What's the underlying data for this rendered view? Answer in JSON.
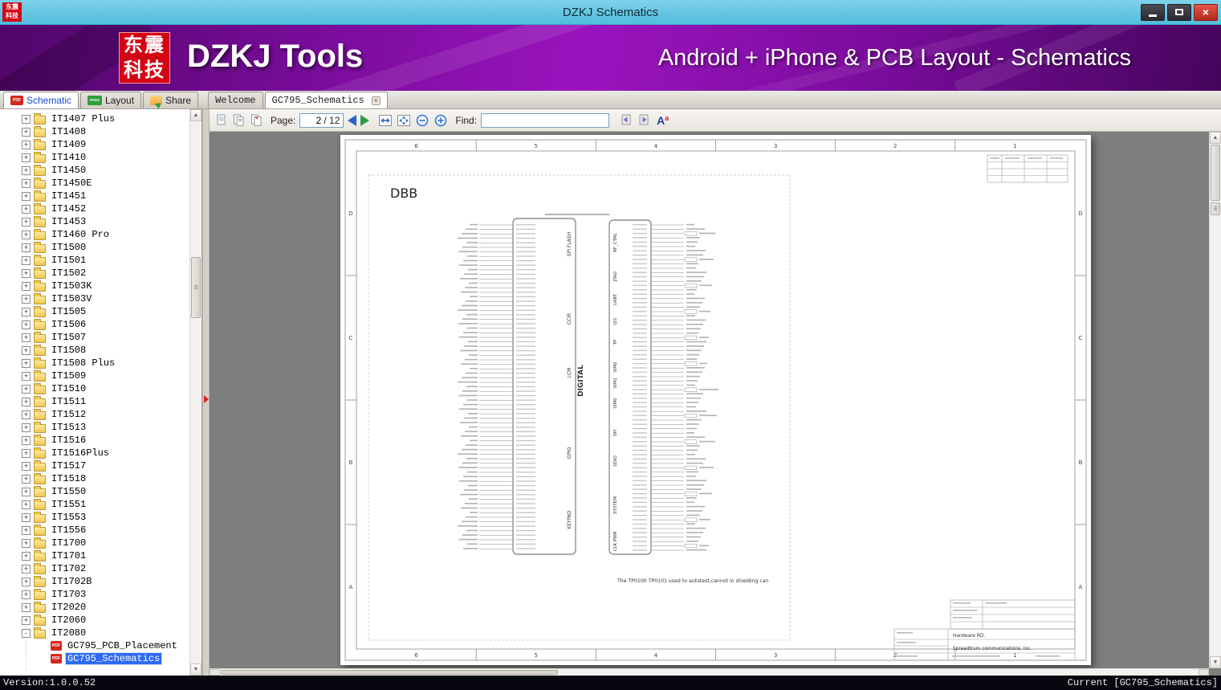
{
  "window": {
    "title": "DZKJ Schematics"
  },
  "banner": {
    "logo_line1": "东震",
    "logo_line2": "科技",
    "brand": "DZKJ Tools",
    "tagline": "Android + iPhone & PCB Layout - Schematics"
  },
  "icons": {
    "pdf_badge": "PDF",
    "pads_badge": "PADS",
    "font_big": "A",
    "font_small": "a"
  },
  "tabs": {
    "app": [
      {
        "label": "Schematic",
        "active": true
      },
      {
        "label": "Layout",
        "active": false
      },
      {
        "label": "Share",
        "active": false
      }
    ],
    "docs": [
      {
        "label": "Welcome",
        "active": false
      },
      {
        "label": "GC795_Schematics",
        "active": true
      }
    ]
  },
  "toolbar": {
    "page_label": "Page:",
    "page_value": "2",
    "page_total": "/ 12",
    "find_label": "Find:",
    "find_value": ""
  },
  "sidebar": {
    "folders": [
      "IT1407 Plus",
      "IT1408",
      "IT1409",
      "IT1410",
      "IT1450",
      "IT1450E",
      "IT1451",
      "IT1452",
      "IT1453",
      "IT1460 Pro",
      "IT1500",
      "IT1501",
      "IT1502",
      "IT1503K",
      "IT1503V",
      "IT1505",
      "IT1506",
      "IT1507",
      "IT1508",
      "IT1508 Plus",
      "IT1509",
      "IT1510",
      "IT1511",
      "IT1512",
      "IT1513",
      "IT1516",
      "IT1516Plus",
      "IT1517",
      "IT1518",
      "IT1550",
      "IT1551",
      "IT1553",
      "IT1556",
      "IT1700",
      "IT1701",
      "IT1702",
      "IT1702B",
      "IT1703",
      "IT2020",
      "IT2060"
    ],
    "expanded": {
      "name": "IT2080",
      "children": [
        {
          "label": "GC795_PCB_Placement",
          "selected": false
        },
        {
          "label": "GC795_Schematics",
          "selected": true
        }
      ]
    }
  },
  "schematic": {
    "page_title": "DBB",
    "column_labels": [
      "6",
      "5",
      "4",
      "3",
      "2",
      "1"
    ],
    "row_labels": [
      "D",
      "C",
      "B",
      "A"
    ],
    "left_blocks": [
      "SPI FLASH",
      "CCIR",
      "LCM",
      "GPIO",
      "KEYPAD"
    ],
    "chip_label": "DIGITAL",
    "right_blocks": [
      "RF_CTRL",
      "JTAG",
      "UART",
      "I2S",
      "TP",
      "SIM2",
      "SIM1",
      "SIM0",
      "SPI",
      "SDIO",
      "SYSTEM",
      "CLK PWR"
    ],
    "note": "The TP0100 TP0101 used to autotest,cannot in shielding can",
    "title_block": {
      "department": "Hardware RD.",
      "company": "Spreadtrum communications, Inc."
    }
  },
  "statusbar": {
    "left": "Version:1.0.0.52",
    "right": "Current [GC795_Schematics]"
  },
  "colors": {
    "titlebar_blue": "#5cc3e2",
    "banner_purple": "#7c0d9e",
    "selection_blue": "#2e6bf0",
    "close_red": "#c23528",
    "pdf_red": "#d3281c",
    "pads_green": "#2e9e3a"
  }
}
